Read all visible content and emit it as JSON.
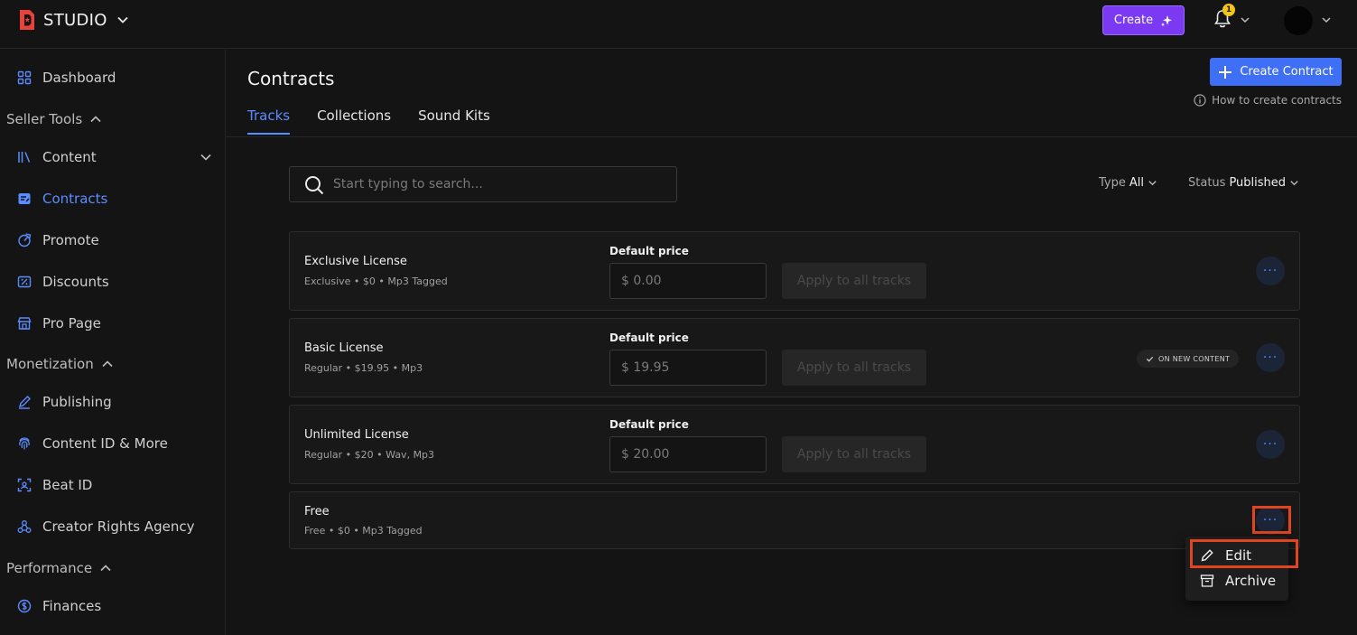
{
  "header": {
    "brand": "STUDIO",
    "create_label": "Create",
    "notification_count": "1",
    "colors": {
      "accent": "#7b3af2",
      "primary": "#3f6ff5",
      "active": "#5b8cff",
      "highlight": "#e0451f"
    }
  },
  "sidebar": {
    "items": [
      {
        "label": "Dashboard",
        "icon": "grid-icon"
      },
      {
        "label": "Content",
        "icon": "library-icon"
      },
      {
        "label": "Contracts",
        "icon": "contract-icon"
      },
      {
        "label": "Promote",
        "icon": "promote-icon"
      },
      {
        "label": "Discounts",
        "icon": "discount-icon"
      },
      {
        "label": "Pro Page",
        "icon": "store-icon"
      },
      {
        "label": "Publishing",
        "icon": "pen-icon"
      },
      {
        "label": "Content ID & More",
        "icon": "fingerprint-icon"
      },
      {
        "label": "Beat ID",
        "icon": "scan-icon"
      },
      {
        "label": "Creator Rights Agency",
        "icon": "network-icon"
      },
      {
        "label": "Finances",
        "icon": "dollar-icon"
      }
    ],
    "sections": {
      "seller_tools": "Seller Tools",
      "monetization": "Monetization",
      "performance": "Performance"
    }
  },
  "main": {
    "title": "Contracts",
    "tabs": [
      {
        "label": "Tracks"
      },
      {
        "label": "Collections"
      },
      {
        "label": "Sound Kits"
      }
    ],
    "create_contract_label": "Create Contract",
    "howto_label": "How to create contracts",
    "search": {
      "placeholder": "Start typing to search..."
    },
    "filters": {
      "type_label": "Type",
      "type_value": "All",
      "status_label": "Status",
      "status_value": "Published"
    },
    "default_price_label": "Default price",
    "apply_label": "Apply to all tracks",
    "on_new_content_label": "ON NEW CONTENT",
    "contracts": [
      {
        "name": "Exclusive License",
        "meta": "Exclusive • $0 • Mp3 Tagged",
        "price": "$ 0.00"
      },
      {
        "name": "Basic License",
        "meta": "Regular • $19.95 • Mp3",
        "price": "$ 19.95"
      },
      {
        "name": "Unlimited License",
        "meta": "Regular • $20 • Wav, Mp3",
        "price": "$ 20.00"
      },
      {
        "name": "Free",
        "meta": "Free • $0 • Mp3 Tagged"
      }
    ],
    "more_symbol": "···",
    "menu": {
      "edit": "Edit",
      "archive": "Archive"
    }
  }
}
